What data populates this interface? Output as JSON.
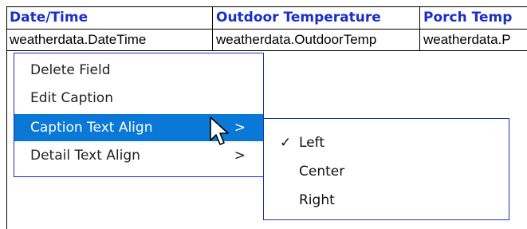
{
  "columns": [
    {
      "header": "Date/Time",
      "value": "weatherdata.DateTime"
    },
    {
      "header": "Outdoor Temperature",
      "value": "weatherdata.OutdoorTemp"
    },
    {
      "header": "Porch Temp",
      "value": "weatherdata.P"
    }
  ],
  "context_menu": {
    "items": [
      {
        "label": "Delete Field",
        "arrow": ""
      },
      {
        "label": "Edit Caption",
        "arrow": ""
      },
      {
        "label": "Caption Text Align",
        "arrow": ">"
      },
      {
        "label": "Detail Text Align",
        "arrow": ">"
      }
    ],
    "active_index": 2
  },
  "submenu": {
    "items": [
      {
        "label": "Left",
        "check": "✓"
      },
      {
        "label": "Center",
        "check": ""
      },
      {
        "label": "Right",
        "check": ""
      }
    ]
  },
  "colors": {
    "header_text": "#1a30c8",
    "menu_border": "#1a30c8",
    "highlight": "#0a78d7"
  },
  "icons": {
    "cursor": "arrow-pointer-icon"
  }
}
